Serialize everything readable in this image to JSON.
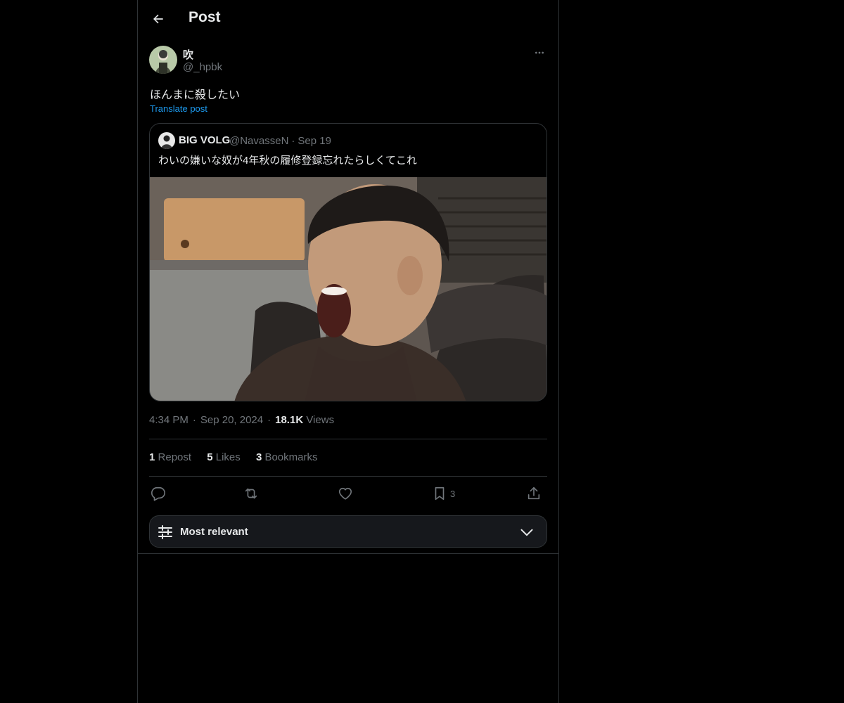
{
  "header": {
    "title": "Post"
  },
  "post": {
    "author_name": "吹",
    "author_handle": "@_hpbk",
    "text": "ほんまに殺したい",
    "translate_label": "Translate post",
    "time": "4:34 PM",
    "date": "Sep 20, 2024",
    "views_count": "18.1K",
    "views_label": "Views"
  },
  "quote": {
    "name": "BIG VOLG",
    "handle": "@NavasseN",
    "date": "Sep 19",
    "text": "わいの嫌いな奴が4年秋の履修登録忘れたらしくてこれ"
  },
  "stats": {
    "reposts_count": "1",
    "reposts_label": "Repost",
    "likes_count": "5",
    "likes_label": "Likes",
    "bookmarks_count": "3",
    "bookmarks_label": "Bookmarks"
  },
  "actions": {
    "bookmark_count": "3"
  },
  "sort": {
    "label": "Most relevant"
  },
  "colors": {
    "background": "#000000",
    "text": "#e7e9ea",
    "secondary": "#71767b",
    "accent": "#1d9bf0",
    "border": "#2f3336"
  },
  "icons": [
    "back-arrow-icon",
    "more-icon",
    "reply-icon",
    "repost-icon",
    "like-icon",
    "bookmark-icon",
    "share-icon",
    "filter-icon",
    "chevron-down-icon"
  ]
}
